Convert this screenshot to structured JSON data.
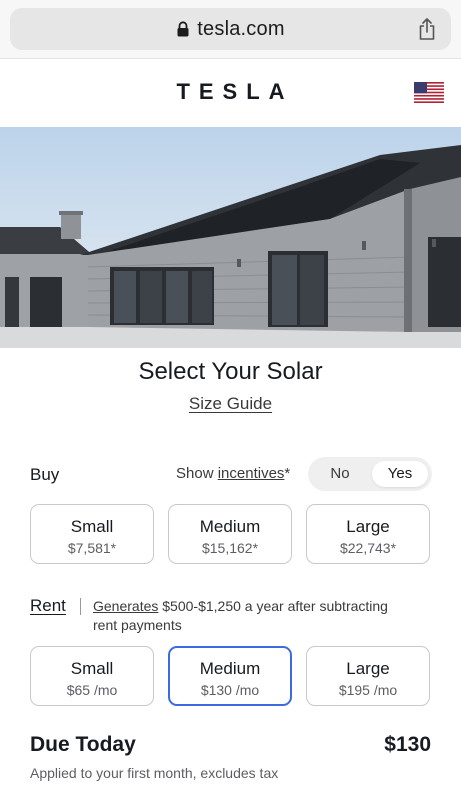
{
  "browser": {
    "url": "tesla.com"
  },
  "header": {
    "logo": "TESLA"
  },
  "page": {
    "title": "Select Your Solar",
    "size_guide": "Size Guide"
  },
  "buy": {
    "label": "Buy",
    "show_text": "Show",
    "incentives_link": "incentives",
    "asterisk": "*",
    "toggle": {
      "no": "No",
      "yes": "Yes",
      "selected": "Yes"
    },
    "options": [
      {
        "name": "Small",
        "price": "$7,581*"
      },
      {
        "name": "Medium",
        "price": "$15,162*"
      },
      {
        "name": "Large",
        "price": "$22,743*"
      }
    ]
  },
  "rent": {
    "label": "Rent",
    "generates_link": "Generates",
    "description": " $500-$1,250 a year after subtracting rent payments",
    "selected": "Medium",
    "options": [
      {
        "name": "Small",
        "price": "$65 /mo"
      },
      {
        "name": "Medium",
        "price": "$130 /mo"
      },
      {
        "name": "Large",
        "price": "$195 /mo"
      }
    ]
  },
  "due": {
    "label": "Due Today",
    "amount": "$130",
    "note": "Applied to your first month, excludes tax"
  }
}
